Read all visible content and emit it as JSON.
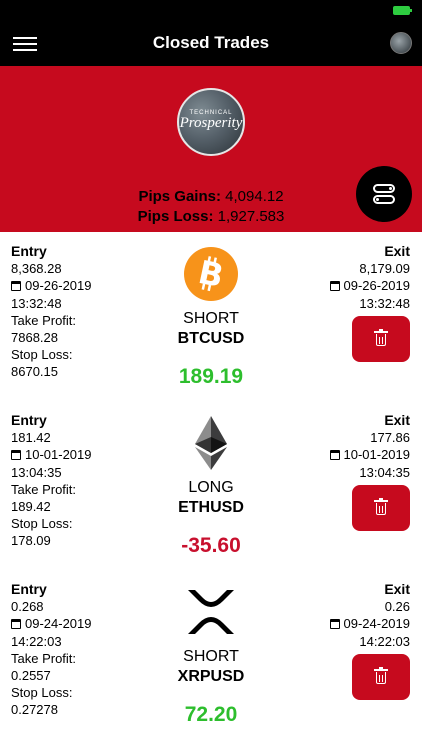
{
  "header": {
    "title": "Closed Trades",
    "menu_icon": "hamburger-icon",
    "brand_small": "TECHNICAL",
    "brand_big": "Prosperity",
    "colors": {
      "brand_red": "#c60a1e",
      "bar": "#000000"
    }
  },
  "summary": {
    "pips_gains_label": "Pips Gains:",
    "pips_gains_value": "4,094.12",
    "pips_loss_label": "Pips Loss:",
    "pips_loss_value": "1,927.583",
    "toggle_icon": "toggle-icon"
  },
  "trades": [
    {
      "entry_label": "Entry",
      "entry_price": "8,368.28",
      "entry_date": "09-26-2019",
      "entry_time": "13:32:48",
      "take_profit_label": "Take Profit:",
      "take_profit": "7868.28",
      "stop_loss_label": "Stop Loss:",
      "stop_loss": "8670.15",
      "side": "SHORT",
      "pair": "BTCUSD",
      "pnl": "189.19",
      "pnl_color": "#2dbe2d",
      "exit_label": "Exit",
      "exit_price": "8,179.09",
      "exit_date": "09-26-2019",
      "exit_time": "13:32:48",
      "icon": "bitcoin-icon"
    },
    {
      "entry_label": "Entry",
      "entry_price": "181.42",
      "entry_date": "10-01-2019",
      "entry_time": "13:04:35",
      "take_profit_label": "Take Profit:",
      "take_profit": "189.42",
      "stop_loss_label": "Stop Loss:",
      "stop_loss": "178.09",
      "side": "LONG",
      "pair": "ETHUSD",
      "pnl": "-35.60",
      "pnl_color": "#c8102e",
      "exit_label": "Exit",
      "exit_price": "177.86",
      "exit_date": "10-01-2019",
      "exit_time": "13:04:35",
      "icon": "ethereum-icon"
    },
    {
      "entry_label": "Entry",
      "entry_price": "0.268",
      "entry_date": "09-24-2019",
      "entry_time": "14:22:03",
      "take_profit_label": "Take Profit:",
      "take_profit": "0.2557",
      "stop_loss_label": "Stop Loss:",
      "stop_loss": "0.27278",
      "side": "SHORT",
      "pair": "XRPUSD",
      "pnl": "72.20",
      "pnl_color": "#2dbe2d",
      "exit_label": "Exit",
      "exit_price": "0.26",
      "exit_date": "09-24-2019",
      "exit_time": "14:22:03",
      "icon": "xrp-icon"
    }
  ]
}
